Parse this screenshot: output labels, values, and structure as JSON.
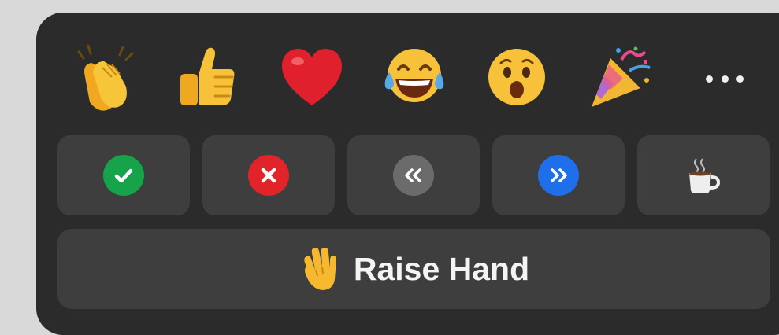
{
  "reactions": [
    {
      "icon": "clapping-hands-icon",
      "color": "#f5b82e"
    },
    {
      "icon": "thumbs-up-icon",
      "color": "#f5b82e"
    },
    {
      "icon": "red-heart-icon",
      "color": "#e0202c"
    },
    {
      "icon": "tears-of-joy-icon",
      "color": "#f7c23a"
    },
    {
      "icon": "surprised-face-icon",
      "color": "#f7c23a"
    },
    {
      "icon": "party-popper-icon",
      "color": "#d98ac8"
    }
  ],
  "more_icon": "ellipsis-icon",
  "feedback": [
    {
      "icon": "check-icon",
      "color": "#16a34a"
    },
    {
      "icon": "cross-icon",
      "color": "#e0242a"
    },
    {
      "icon": "slow-down-icon",
      "color": "#6b6b6b"
    },
    {
      "icon": "speed-up-icon",
      "color": "#1f6feb"
    },
    {
      "icon": "coffee-cup-icon",
      "color": "#eeeeee"
    }
  ],
  "raise_hand": {
    "label": "Raise Hand",
    "icon": "raised-hand-icon",
    "color": "#f5b82e"
  },
  "colors": {
    "panel": "#2b2b2b",
    "tile": "#3e3e3e",
    "background": "#d9d9d9"
  }
}
